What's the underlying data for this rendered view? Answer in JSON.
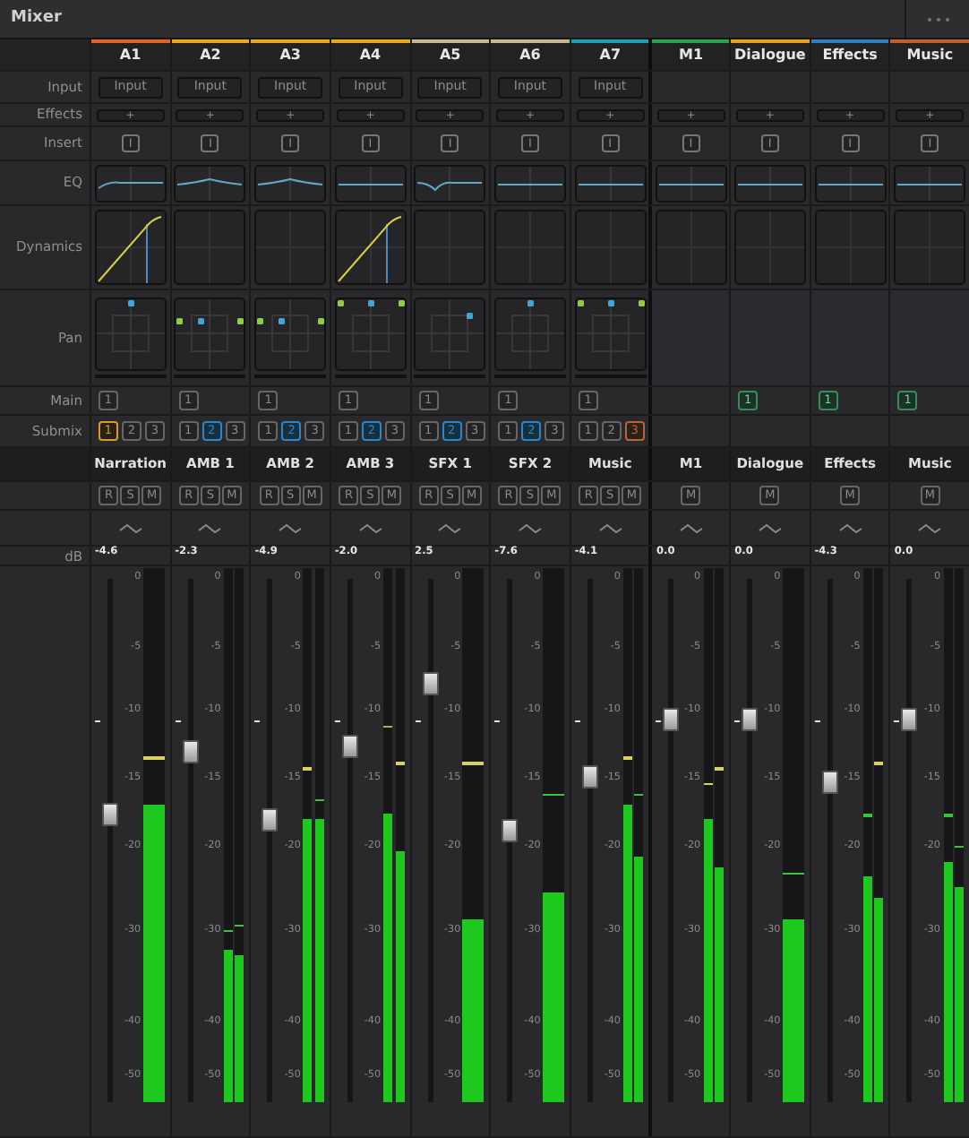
{
  "window": {
    "title": "Mixer"
  },
  "row_labels": [
    "Input",
    "Effects",
    "Insert",
    "EQ",
    "Dynamics",
    "Pan",
    "Main",
    "Submix",
    "dB"
  ],
  "channels": [
    {
      "name": "A1",
      "color": "#e0642a",
      "input": "Input",
      "effects": "+",
      "insert": "I",
      "eq": {
        "kind": "shelf"
      },
      "dynamics": {
        "kind": "active"
      },
      "pan": {
        "kind": "mono-top"
      },
      "main": {
        "label": "1",
        "selected": false
      },
      "submix": [
        {
          "label": "1",
          "selected": true
        },
        {
          "label": "2",
          "selected": false
        },
        {
          "label": "3",
          "selected": false
        }
      ],
      "track": "Narration",
      "buttons": [
        "R",
        "S",
        "M"
      ],
      "reading": "-4.6",
      "fader": {
        "level": 0.55
      },
      "meters": [
        {
          "level": 0.57,
          "peak": {
            "level": 0.66,
            "color": "#d8d060"
          }
        }
      ],
      "scale": [
        "0",
        "-5",
        "-10",
        "-15",
        "-20",
        "-30",
        "-40",
        "-50"
      ]
    },
    {
      "name": "A2",
      "color": "#e8a820",
      "input": "Input",
      "effects": "+",
      "insert": "I",
      "eq": {
        "kind": "bump"
      },
      "dynamics": {
        "kind": "idle"
      },
      "pan": {
        "kind": "stereo-middle"
      },
      "main": {
        "label": "1",
        "selected": false
      },
      "submix": [
        {
          "label": "1",
          "selected": false
        },
        {
          "label": "2",
          "selected": true
        },
        {
          "label": "3",
          "selected": false
        }
      ],
      "track": "AMB 1",
      "buttons": [
        "R",
        "S",
        "M"
      ],
      "reading": "-2.3",
      "fader": {
        "level": 0.67
      },
      "meters": [
        {
          "level": 0.29,
          "peak": {
            "level": 0.33,
            "color": "#3cc040"
          }
        },
        {
          "level": 0.28,
          "peak": {
            "level": 0.34,
            "color": "#3cc040"
          }
        }
      ],
      "scale": [
        "0",
        "-5",
        "-10",
        "-15",
        "-20",
        "-30",
        "-40",
        "-50"
      ]
    },
    {
      "name": "A3",
      "color": "#e8a820",
      "input": "Input",
      "effects": "+",
      "insert": "I",
      "eq": {
        "kind": "bump"
      },
      "dynamics": {
        "kind": "idle"
      },
      "pan": {
        "kind": "stereo-middle"
      },
      "main": {
        "label": "1",
        "selected": false
      },
      "submix": [
        {
          "label": "1",
          "selected": false
        },
        {
          "label": "2",
          "selected": true
        },
        {
          "label": "3",
          "selected": false
        }
      ],
      "track": "AMB 2",
      "buttons": [
        "R",
        "S",
        "M"
      ],
      "reading": "-4.9",
      "fader": {
        "level": 0.54
      },
      "meters": [
        {
          "level": 0.54,
          "peak": {
            "level": 0.64,
            "color": "#d8d060"
          }
        },
        {
          "level": 0.54,
          "peak": {
            "level": 0.58,
            "color": "#3cc040"
          }
        }
      ],
      "scale": [
        "0",
        "-5",
        "-10",
        "-15",
        "-20",
        "-30",
        "-40",
        "-50"
      ]
    },
    {
      "name": "A4",
      "color": "#e8a820",
      "input": "Input",
      "effects": "+",
      "insert": "I",
      "eq": {
        "kind": "flat"
      },
      "dynamics": {
        "kind": "active"
      },
      "pan": {
        "kind": "stereo-top"
      },
      "main": {
        "label": "1",
        "selected": false
      },
      "submix": [
        {
          "label": "1",
          "selected": false
        },
        {
          "label": "2",
          "selected": true
        },
        {
          "label": "3",
          "selected": false
        }
      ],
      "track": "AMB 3",
      "buttons": [
        "R",
        "S",
        "M"
      ],
      "reading": "-2.0",
      "fader": {
        "level": 0.68
      },
      "meters": [
        {
          "level": 0.55,
          "peak": {
            "level": 0.72,
            "color": "#b8a850"
          }
        },
        {
          "level": 0.48,
          "peak": {
            "level": 0.65,
            "color": "#d8d060"
          }
        }
      ],
      "scale": [
        "0",
        "-5",
        "-10",
        "-15",
        "-20",
        "-30",
        "-40",
        "-50"
      ]
    },
    {
      "name": "A5",
      "color": "#c8b890",
      "input": "Input",
      "effects": "+",
      "insert": "I",
      "eq": {
        "kind": "dip"
      },
      "dynamics": {
        "kind": "idle"
      },
      "pan": {
        "kind": "mono-right"
      },
      "main": {
        "label": "1",
        "selected": false
      },
      "submix": [
        {
          "label": "1",
          "selected": false
        },
        {
          "label": "2",
          "selected": true
        },
        {
          "label": "3",
          "selected": false
        }
      ],
      "track": "SFX 1",
      "buttons": [
        "R",
        "S",
        "M"
      ],
      "reading": "2.5",
      "fader": {
        "level": 0.8
      },
      "meters": [
        {
          "level": 0.35,
          "peak": {
            "level": 0.65,
            "color": "#d8d060"
          }
        }
      ],
      "scale": [
        "0",
        "-5",
        "-10",
        "-15",
        "-20",
        "-30",
        "-40",
        "-50"
      ]
    },
    {
      "name": "A6",
      "color": "#c8b890",
      "input": "Input",
      "effects": "+",
      "insert": "I",
      "eq": {
        "kind": "flat"
      },
      "dynamics": {
        "kind": "idle"
      },
      "pan": {
        "kind": "mono-top"
      },
      "main": {
        "label": "1",
        "selected": false
      },
      "submix": [
        {
          "label": "1",
          "selected": false
        },
        {
          "label": "2",
          "selected": true
        },
        {
          "label": "3",
          "selected": false
        }
      ],
      "track": "SFX 2",
      "buttons": [
        "R",
        "S",
        "M"
      ],
      "reading": "-7.6",
      "fader": {
        "level": 0.52
      },
      "meters": [
        {
          "level": 0.4,
          "peak": {
            "level": 0.59,
            "color": "#3cc040"
          }
        }
      ],
      "scale": [
        "0",
        "-5",
        "-10",
        "-15",
        "-20",
        "-30",
        "-40",
        "-50"
      ]
    },
    {
      "name": "A7",
      "color": "#1fa0b0",
      "input": "Input",
      "effects": "+",
      "insert": "I",
      "eq": {
        "kind": "flat"
      },
      "dynamics": {
        "kind": "idle"
      },
      "pan": {
        "kind": "stereo-top"
      },
      "main": {
        "label": "1",
        "selected": false
      },
      "submix": [
        {
          "label": "1",
          "selected": false
        },
        {
          "label": "2",
          "selected": false
        },
        {
          "label": "3",
          "selected": true
        }
      ],
      "track": "Music",
      "buttons": [
        "R",
        "S",
        "M"
      ],
      "reading": "-4.1",
      "fader": {
        "level": 0.62
      },
      "meters": [
        {
          "level": 0.57,
          "peak": {
            "level": 0.66,
            "color": "#d8d060"
          }
        },
        {
          "level": 0.47,
          "peak": {
            "level": 0.59,
            "color": "#3cc040"
          }
        }
      ],
      "scale": [
        "0",
        "-5",
        "-10",
        "-15",
        "-20",
        "-30",
        "-40",
        "-50"
      ]
    },
    {
      "name": "M1",
      "color": "#2aa050",
      "effects": "+",
      "insert": "I",
      "eq": {
        "kind": "flat"
      },
      "dynamics": {
        "kind": "idle"
      },
      "track": "M1",
      "buttons": [
        "M"
      ],
      "reading": "0.0",
      "fader": {
        "level": 0.73
      },
      "meters": [
        {
          "level": 0.54,
          "peak": {
            "level": 0.61,
            "color": "#d8d060"
          }
        },
        {
          "level": 0.45,
          "peak": {
            "level": 0.64,
            "color": "#d8d060"
          }
        }
      ],
      "scale": [
        "0",
        "-5",
        "-10",
        "-15",
        "-20",
        "-30",
        "-40",
        "-50"
      ]
    },
    {
      "name": "Dialogue",
      "color": "#e8a020",
      "effects": "+",
      "insert": "I",
      "eq": {
        "kind": "flat"
      },
      "dynamics": {
        "kind": "idle"
      },
      "main": {
        "label": "1",
        "selected": true
      },
      "track": "Dialogue",
      "buttons": [
        "M"
      ],
      "reading": "0.0",
      "fader": {
        "level": 0.73
      },
      "meters": [
        {
          "level": 0.35,
          "peak": {
            "level": 0.44,
            "color": "#3cc040"
          }
        }
      ],
      "scale": [
        "0",
        "-5",
        "-10",
        "-15",
        "-20",
        "-30",
        "-40",
        "-50"
      ]
    },
    {
      "name": "Effects",
      "color": "#2a80c0",
      "effects": "+",
      "insert": "I",
      "eq": {
        "kind": "flat"
      },
      "dynamics": {
        "kind": "idle"
      },
      "main": {
        "label": "1",
        "selected": true
      },
      "track": "Effects",
      "buttons": [
        "M"
      ],
      "reading": "-4.3",
      "fader": {
        "level": 0.61
      },
      "meters": [
        {
          "level": 0.43,
          "peak": {
            "level": 0.55,
            "color": "#3cc040"
          }
        },
        {
          "level": 0.39,
          "peak": {
            "level": 0.65,
            "color": "#d8d060"
          }
        }
      ],
      "scale": [
        "0",
        "-5",
        "-10",
        "-15",
        "-20",
        "-30",
        "-40",
        "-50"
      ]
    },
    {
      "name": "Music",
      "color": "#c06030",
      "effects": "+",
      "insert": "I",
      "eq": {
        "kind": "flat"
      },
      "dynamics": {
        "kind": "idle"
      },
      "main": {
        "label": "1",
        "selected": true
      },
      "track": "Music",
      "buttons": [
        "M"
      ],
      "reading": "0.0",
      "fader": {
        "level": 0.73
      },
      "meters": [
        {
          "level": 0.46,
          "peak": {
            "level": 0.55,
            "color": "#3cc040"
          }
        },
        {
          "level": 0.41,
          "peak": {
            "level": 0.49,
            "color": "#3cc040"
          }
        }
      ],
      "scale": [
        "0",
        "-5",
        "-10",
        "-15",
        "-20",
        "-30",
        "-40",
        "-50"
      ]
    }
  ]
}
